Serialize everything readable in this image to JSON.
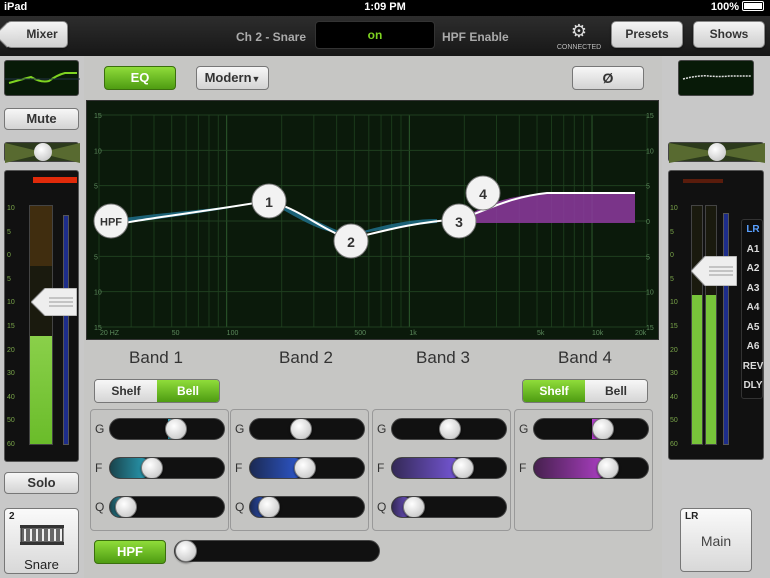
{
  "status_bar": {
    "carrier": "iPad",
    "time": "1:09 PM",
    "battery": "100%"
  },
  "top_bar": {
    "back_label": "Mixer",
    "channel_name": "Ch 2 - Snare",
    "hpf_state": "on",
    "hpf_enable_label": "HPF Enable",
    "connected_label": "CONNECTED",
    "presets_label": "Presets",
    "shows_label": "Shows"
  },
  "left_strip": {
    "mute_label": "Mute",
    "solo_label": "Solo",
    "channel_number": "2",
    "channel_name": "Snare",
    "meter_scale": [
      "10",
      "5",
      "0",
      "5",
      "10",
      "15",
      "20",
      "30",
      "40",
      "50",
      "60"
    ],
    "fader_level": 0.62,
    "meter_level": 0.45,
    "pan_position": 0.5
  },
  "eq_header": {
    "eq_label": "EQ",
    "mode_label": "Modern",
    "phase_label": "Ø"
  },
  "graph": {
    "db_labels": [
      "15",
      "10",
      "5",
      "0",
      "5",
      "10",
      "15"
    ],
    "freq_labels": [
      "20 HZ",
      "50",
      "100",
      "500",
      "1k",
      "5k",
      "10k",
      "20k"
    ],
    "hpf_node_label": "HPF",
    "node_labels": [
      "1",
      "2",
      "3",
      "4"
    ]
  },
  "bands": [
    {
      "name": "Band 1",
      "shelf_label": "Shelf",
      "bell_label": "Bell",
      "mode": "Bell",
      "G": 0.58,
      "F": 0.33,
      "Q": 0.05,
      "color": "#2aa7c0"
    },
    {
      "name": "Band 2",
      "G": 0.43,
      "F": 0.47,
      "Q": 0.08,
      "color": "#2f5bd6"
    },
    {
      "name": "Band 3",
      "G": 0.5,
      "F": 0.64,
      "Q": 0.12,
      "color": "#7a5ae0"
    },
    {
      "name": "Band 4",
      "shelf_label": "Shelf",
      "bell_label": "Bell",
      "mode": "Shelf",
      "G": 0.62,
      "F": 0.67,
      "Q": null,
      "color": "#b040c8"
    }
  ],
  "param_labels": {
    "g": "G",
    "f": "F",
    "q": "Q"
  },
  "hpf_control": {
    "label": "HPF",
    "value": 0.0
  },
  "right_strip": {
    "buses": [
      "LR",
      "A1",
      "A2",
      "A3",
      "A4",
      "A5",
      "A6",
      "REV",
      "DLY"
    ],
    "selected_bus": "LR",
    "meter_scale": [
      "10",
      "5",
      "0",
      "5",
      "10",
      "15",
      "20",
      "30",
      "40",
      "50",
      "60"
    ],
    "main_tag": "LR",
    "main_label": "Main",
    "fader_level": 0.75,
    "meter_level": 0.62
  },
  "colors": {
    "accent_green": "#6fbf1f",
    "graph_bg": "#0b1a0b",
    "band4_fill": "#8e3aa0",
    "band12_fill": "#1e6e8a"
  }
}
